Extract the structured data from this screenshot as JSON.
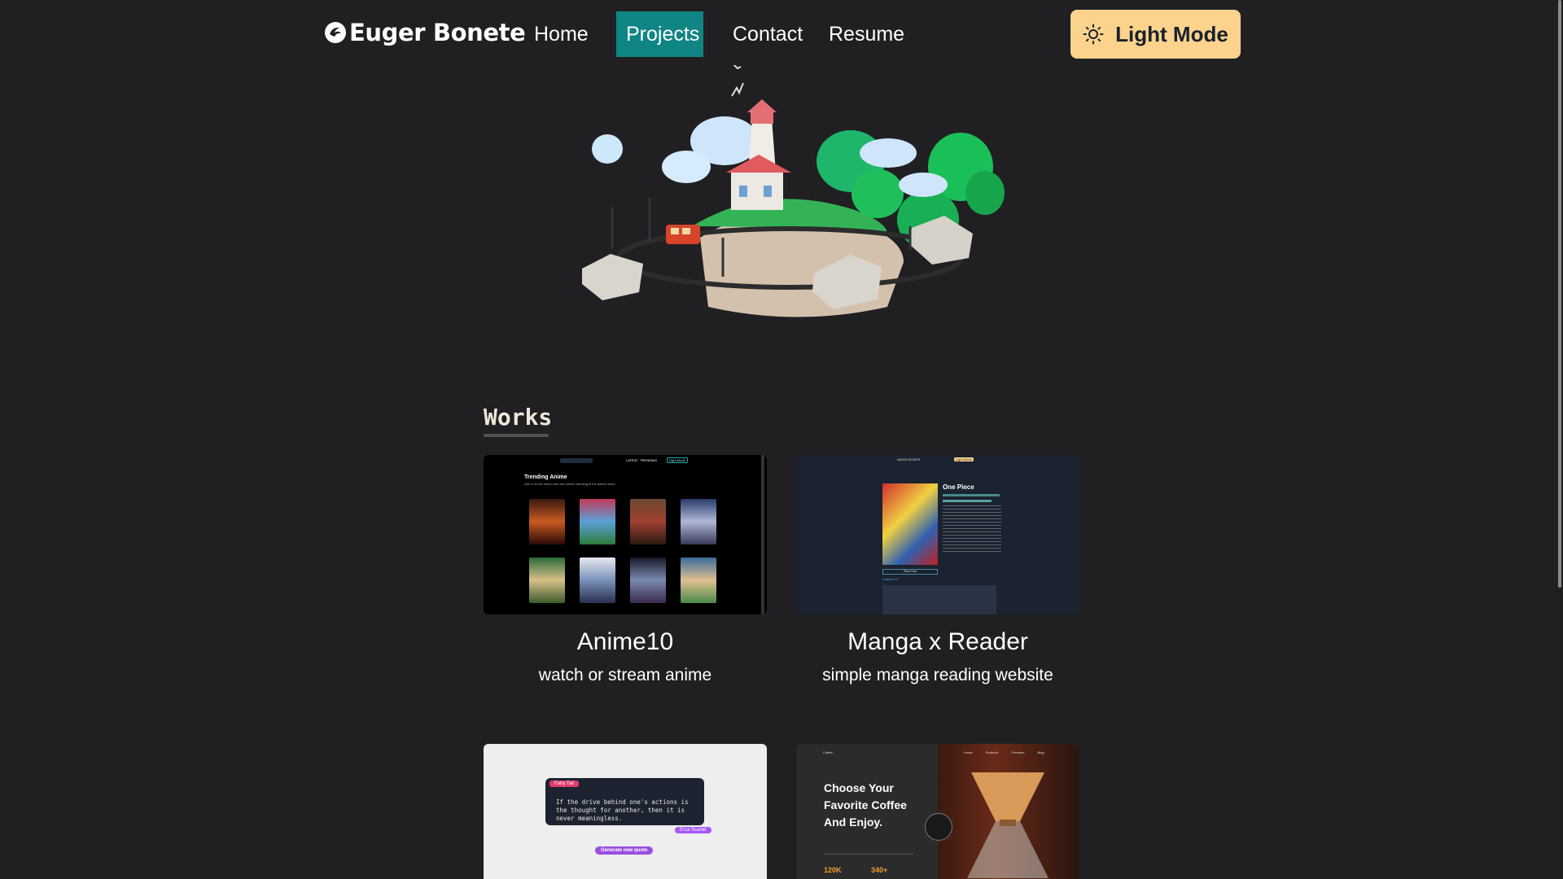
{
  "nav": {
    "brand": "Euger Bonete",
    "links": [
      {
        "label": "Home"
      },
      {
        "label": "Projects"
      },
      {
        "label": "Contact"
      },
      {
        "label": "Resume"
      }
    ],
    "mode_button": "Light Mode",
    "active_color": "#0f8584",
    "mode_button_color": "#fbd38d"
  },
  "works": {
    "title": "Works",
    "projects": [
      {
        "title": "Anime10",
        "description": "watch or stream anime"
      },
      {
        "title": "Manga x Reader",
        "description": "simple manga reading website"
      },
      {
        "title": "",
        "description": ""
      },
      {
        "title": "",
        "description": ""
      }
    ]
  },
  "thumbs": {
    "anime": {
      "heading": "Trending Anime",
      "subheading": "Get in on the action and see what's trending in the anime world",
      "nav_items": [
        "LATEST",
        "TRENDING"
      ],
      "button": "Light Mode"
    },
    "manga": {
      "brand": "MANGA READER",
      "button": "Light Mode",
      "manga_title": "One Piece",
      "read_button": "Read Now",
      "chapter_label": "Chapter List"
    },
    "quote": {
      "series_tag": "Fairy Tail",
      "quote_text": "If the drive behind one's actions is the thought for another, then it is never meaningless.",
      "character_tag": "Erza Scarlet",
      "button": "Generate new quote"
    },
    "coffee": {
      "brand": "Coffee.",
      "nav_items": [
        "Home",
        "Products",
        "Premium",
        "Blog"
      ],
      "headline_lines": [
        "Choose Your",
        "Favorite Coffee",
        "And Enjoy."
      ],
      "stats": [
        "120K",
        "340+"
      ]
    }
  }
}
